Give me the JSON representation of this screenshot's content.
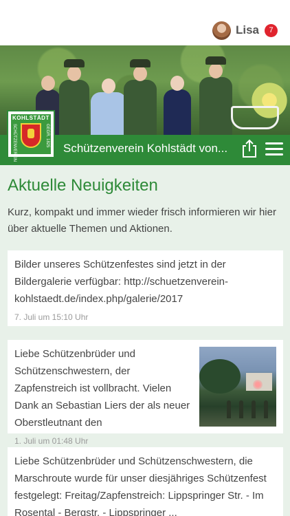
{
  "user": {
    "name": "Lisa",
    "notification_count": "7"
  },
  "header": {
    "logo_text": "KOHLSTÄDT",
    "logo_side_left": "SCHÜTZENVEREIN",
    "logo_side_right": "GEGR. 1825",
    "site_title": "Schützenverein Kohlstädt von..."
  },
  "main": {
    "title": "Aktuelle Neuigkeiten",
    "intro": "Kurz, kompakt und immer wieder frisch informieren wir hier über aktuelle Themen und Aktionen.",
    "posts": [
      {
        "text": "Bilder unseres Schützenfestes sind jetzt in der Bildergalerie verfügbar: http://schuetzenverein-kohlstaedt.de/index.php/galerie/2017",
        "date": "7. Juli um 15:10 Uhr"
      },
      {
        "text": "Liebe Schützenbrüder und Schützenschwestern, der Zapfenstreich ist vollbracht. Vielen Dank an Sebastian Liers der als neuer Oberstleutnant den",
        "date": "1. Juli um 01:48 Uhr"
      },
      {
        "text": "Liebe Schützenbrüder und Schützenschwestern, die Marschroute wurde für unser diesjähriges Schützenfest festgelegt: Freitag/Zapfenstreich: Lippspringer Str. - Im Rosental - Bergstr. - Lippspringer ..."
      }
    ]
  },
  "colors": {
    "brand_green": "#2e8a38",
    "badge_red": "#e0242e",
    "background": "#e8f1e9"
  },
  "icons": {
    "share": "share-icon",
    "menu": "hamburger-menu-icon"
  }
}
